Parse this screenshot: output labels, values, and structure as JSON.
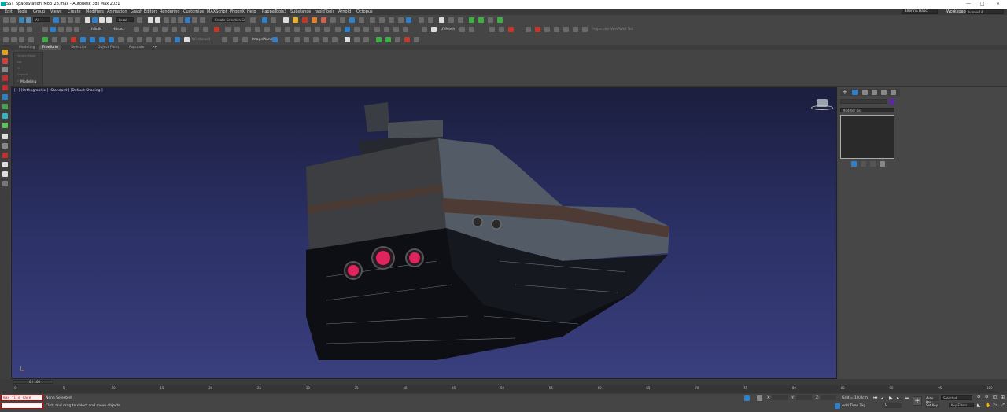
{
  "title_bar": {
    "title": "SST_SpaceStation_Mod_28.max - Autodesk 3ds Max 2021",
    "controls": {
      "minimize": "—",
      "maximize": "□",
      "close": "✕"
    }
  },
  "menu": {
    "items": [
      "Edit",
      "Tools",
      "Group",
      "Views",
      "Create",
      "Modifiers",
      "Animation",
      "Graph Editors",
      "Rendering",
      "Customize",
      "MAXScript",
      "PhoenX",
      "Help",
      "RappaTools3",
      "Substance",
      "rapidTools",
      "Arnold",
      "Octopus"
    ],
    "user": "Ellenna Basc",
    "workspace_label": "Workspaces:",
    "workspace_value": "Ivanov14"
  },
  "toolbar": {
    "selection_filter": "All",
    "coord_system": "Local",
    "selection_set": "Create Selection Se",
    "fetch_label": "hBuilt",
    "hitract_label": "Hitract",
    "unwrap_label": "UVMesh",
    "projection_label": "Projection",
    "vertpaint_label": "VertPaint Tui",
    "xray_label": "Wireboard",
    "imageplane_label": "ImagePlane"
  },
  "ribbon": {
    "tabs": [
      "Modeling",
      "Freeform",
      "Selection",
      "Object Paint",
      "Populate"
    ],
    "active_tab": "Freeform",
    "panel_items": [
      "Polygon Mode",
      "Edit",
      "Tri",
      "Channel",
      "Geometry"
    ],
    "panel_footer": "Modeling"
  },
  "viewport": {
    "label": "[+] [Orthographic ] [Standard ] [Default Shading ]"
  },
  "command_panel": {
    "modifier_list": "Modifier List"
  },
  "timeline": {
    "frame_counter": "0 / 100",
    "ticks": [
      "0",
      "5",
      "10",
      "15",
      "20",
      "25",
      "30",
      "35",
      "40",
      "45",
      "50",
      "55",
      "60",
      "65",
      "70",
      "75",
      "80",
      "85",
      "90",
      "95",
      "100"
    ]
  },
  "status": {
    "script_text": "max file save",
    "selection_status": "None Selected",
    "prompt": "Click and drag to select and move objects",
    "x_label": "X:",
    "y_label": "Y:",
    "z_label": "Z:",
    "grid": "Grid = 10,0cm",
    "add_time_tag": "Add Time Tag",
    "auto_key": "Auto Key",
    "set_key": "Set Key",
    "selected_value": "Selected",
    "key_filters": "Key Filters...",
    "frame_value": "0"
  },
  "colors": {
    "viewport_top": "#1b1e3d",
    "viewport_bottom": "#3a3f7e",
    "engine_glow": "#e0245e",
    "title_bg": "#ffffff",
    "ui_bg": "#444444"
  }
}
